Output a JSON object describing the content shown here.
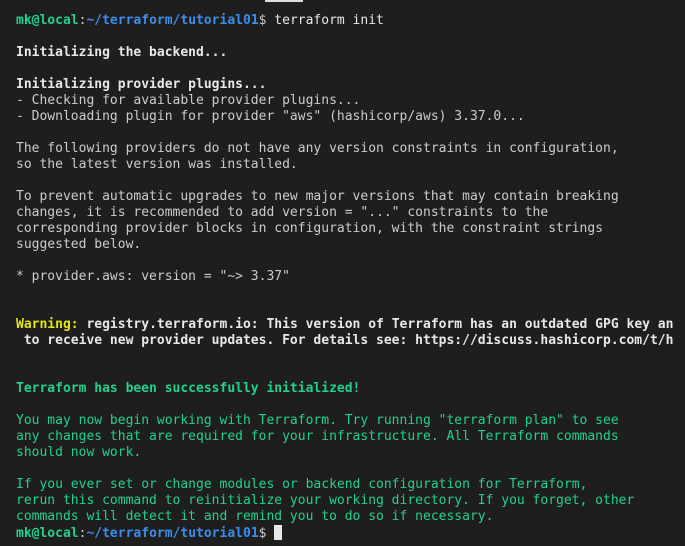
{
  "terminal": {
    "prompt": {
      "user_host": "mk@local",
      "colon": ":",
      "path": "~/terraform/tutorial01",
      "dollar": "$",
      "command": " terraform init"
    },
    "lines": {
      "init_backend": "Initializing the backend...",
      "init_plugins": "Initializing provider plugins...",
      "checking": "- Checking for available provider plugins...",
      "downloading": "- Downloading plugin for provider \"aws\" (hashicorp/aws) 3.37.0...",
      "no_constraints_1": "The following providers do not have any version constraints in configuration,",
      "no_constraints_2": "so the latest version was installed.",
      "prevent_1": "To prevent automatic upgrades to new major versions that may contain breaking",
      "prevent_2": "changes, it is recommended to add version = \"...\" constraints to the",
      "prevent_3": "corresponding provider blocks in configuration, with the constraint strings",
      "prevent_4": "suggested below.",
      "provider_version": "* provider.aws: version = \"~> 3.37\"",
      "warning_label": "Warning:",
      "warning_text_1": " registry.terraform.io: This version of Terraform has an outdated GPG key an",
      "warning_text_2": " to receive new provider updates. For details see: https://discuss.hashicorp.com/t/h",
      "success": "Terraform has been successfully initialized!",
      "next_1": "You may now begin working with Terraform. Try running \"terraform plan\" to see",
      "next_2": "any changes that are required for your infrastructure. All Terraform commands",
      "next_3": "should now work.",
      "reinit_1": "If you ever set or change modules or backend configuration for Terraform,",
      "reinit_2": "rerun this command to reinitialize your working directory. If you forget, other",
      "reinit_3": "commands will detect it and remind you to do so if necessary."
    }
  }
}
